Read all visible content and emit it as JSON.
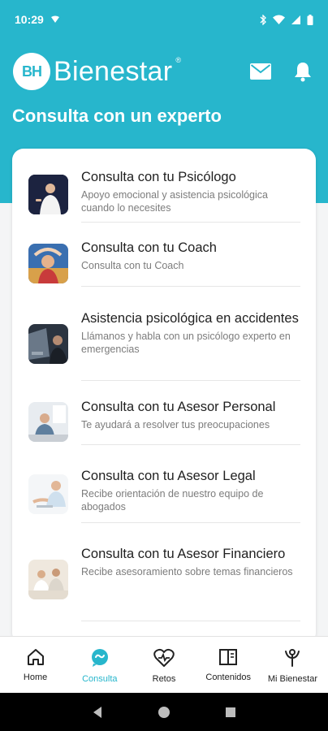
{
  "status": {
    "time": "10:29"
  },
  "header": {
    "logo_mark": "BH",
    "app_name": "Bienestar",
    "trademark": "®",
    "mail_icon": "mail-icon",
    "bell_icon": "bell-icon"
  },
  "page": {
    "title": "Consulta con un experto"
  },
  "items": [
    {
      "title": "Consulta con tu Psicólogo",
      "subtitle": "Apoyo emocional y asistencia psicológica cuando lo necesites"
    },
    {
      "title": "Consulta con tu Coach",
      "subtitle": "Consulta con tu Coach"
    },
    {
      "title": "Asistencia psicológica en accidentes",
      "subtitle": "Llámanos y habla con un psicólogo experto en emergencias"
    },
    {
      "title": "Consulta con tu Asesor Personal",
      "subtitle": "Te ayudará a resolver tus preocupaciones"
    },
    {
      "title": "Consulta con tu Asesor Legal",
      "subtitle": "Recibe orientación de nuestro equipo de abogados"
    },
    {
      "title": "Consulta con tu Asesor Financiero",
      "subtitle": "Recibe asesoramiento sobre temas financieros"
    }
  ],
  "nav": [
    {
      "label": "Home",
      "icon": "home-icon",
      "active": false
    },
    {
      "label": "Consulta",
      "icon": "chat-icon",
      "active": true
    },
    {
      "label": "Retos",
      "icon": "heart-pulse-icon",
      "active": false
    },
    {
      "label": "Contenidos",
      "icon": "book-icon",
      "active": false
    },
    {
      "label": "Mi Bienestar",
      "icon": "person-icon",
      "active": false
    }
  ],
  "colors": {
    "accent": "#27b6cc",
    "title_text": "#1f1f1f",
    "subtitle_text": "#7c7c7c"
  }
}
